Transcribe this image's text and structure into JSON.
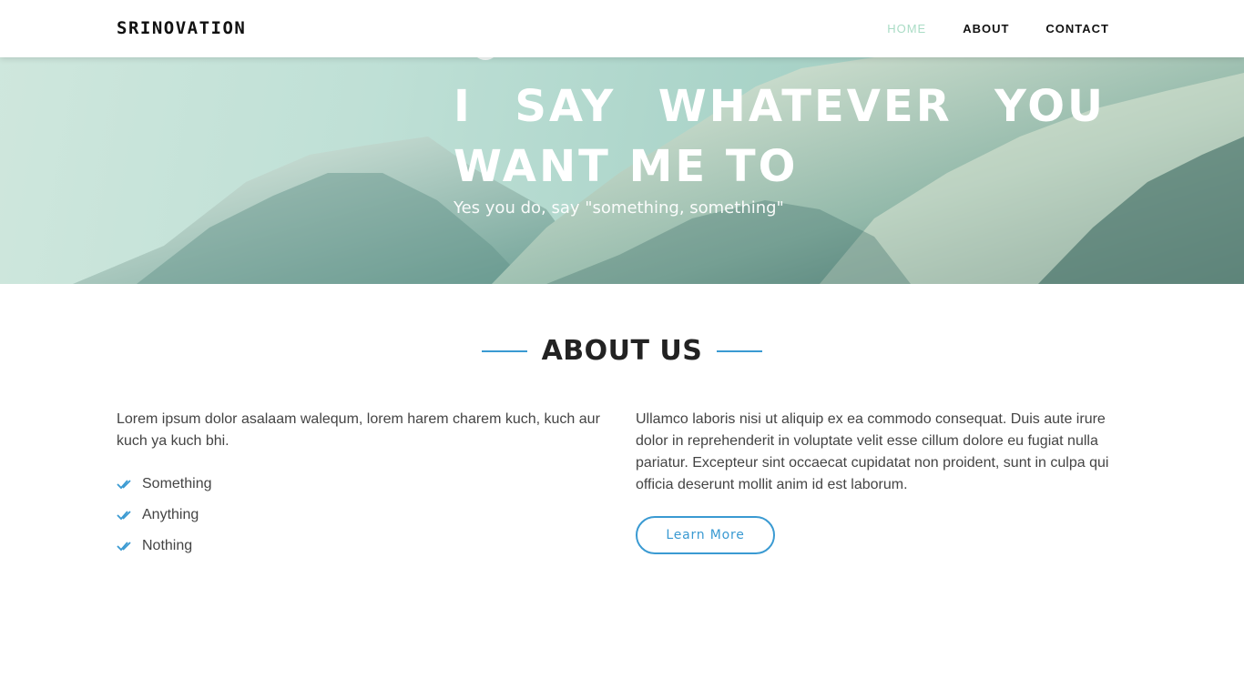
{
  "header": {
    "logo": "SRINOVATION",
    "nav": [
      "HOME",
      "ABOUT",
      "CONTACT"
    ],
    "active_nav": "HOME"
  },
  "hero": {
    "title": "I SAY WHATEVER YOU WANT ME TO",
    "subtitle": "Yes you do, say \"something, something\""
  },
  "about": {
    "heading": "ABOUT US",
    "left_text": "Lorem ipsum dolor asalaam walequm, lorem harem charem kuch, kuch aur kuch ya kuch bhi.",
    "list": [
      "Something",
      "Anything",
      "Nothing"
    ],
    "right_text": "Ullamco laboris nisi ut aliquip ex ea commodo consequat. Duis aute irure dolor in reprehenderit in voluptate velit esse cillum dolore eu fugiat nulla pariatur. Excepteur sint occaecat cupidatat non proident, sunt in culpa qui officia deserunt mollit anim id est laborum.",
    "button": "Learn More"
  },
  "colors": {
    "accent": "#3a9ad2",
    "nav_active": "#a9dcc5",
    "hero_teal": "#9cc7b9"
  },
  "icons": {
    "list_check": "double-check-icon"
  }
}
